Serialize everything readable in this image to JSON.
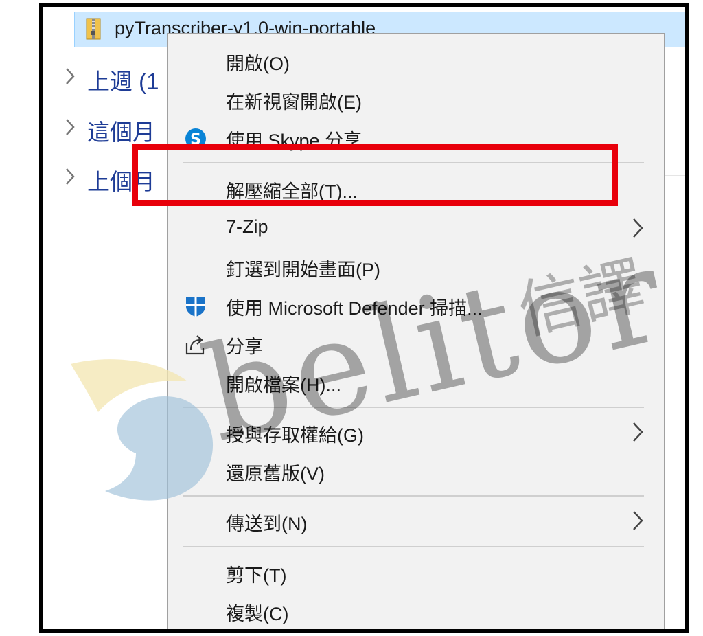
{
  "explorer": {
    "file_name": "pyTranscriber-v1.0-win-portable",
    "groups": [
      {
        "label": "上週 (1"
      },
      {
        "label": "這個月"
      },
      {
        "label": "上個月"
      }
    ]
  },
  "context_menu": {
    "items": [
      {
        "label": "開啟(O)"
      },
      {
        "label": "在新視窗開啟(E)"
      },
      {
        "label": "使用 Skype 分享",
        "icon": "skype-icon"
      },
      {
        "label": "解壓縮全部(T)..."
      },
      {
        "label": "7-Zip"
      },
      {
        "label": "釘選到開始畫面(P)"
      },
      {
        "label": "使用 Microsoft Defender 掃描...",
        "icon": "defender-shield-icon"
      },
      {
        "label": "分享",
        "icon": "share-icon"
      },
      {
        "label": "開啟檔案(H)..."
      },
      {
        "label": "授與存取權給(G)"
      },
      {
        "label": "還原舊版(V)"
      },
      {
        "label": "傳送到(N)"
      },
      {
        "label": "剪下(T)"
      },
      {
        "label": "複製(C)"
      }
    ],
    "highlighted_item": "解壓縮全部(T)..."
  },
  "watermark": {
    "brand": "belitor",
    "chinese": "信譯"
  },
  "colors": {
    "highlight": "#e8000b",
    "selection": "#cce8ff",
    "group_text": "#1e3c96",
    "skype": "#0a84d6",
    "defender": "#1a73c8"
  }
}
